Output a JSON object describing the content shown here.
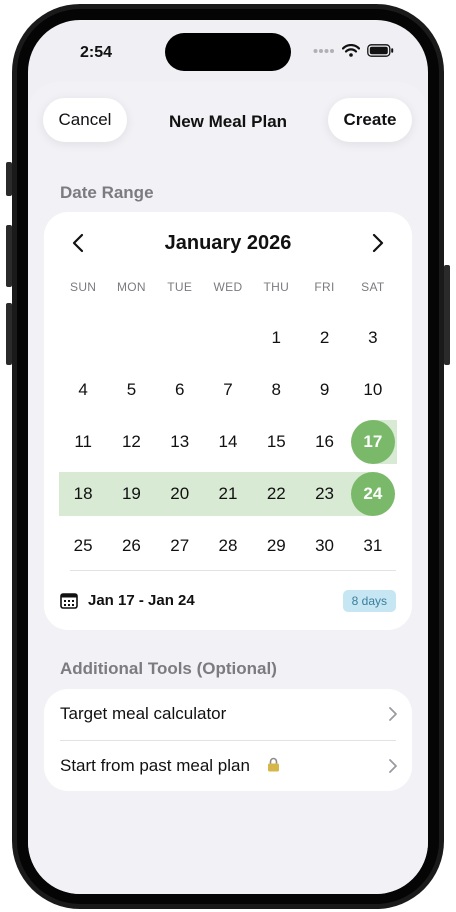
{
  "status_bar": {
    "time": "2:54"
  },
  "header": {
    "cancel_label": "Cancel",
    "title": "New Meal Plan",
    "create_label": "Create"
  },
  "date_range": {
    "section_label": "Date Range",
    "month_title": "January 2026",
    "weekdays": [
      "SUN",
      "MON",
      "TUE",
      "WED",
      "THU",
      "FRI",
      "SAT"
    ],
    "first_weekday_index": 4,
    "days_in_month": 31,
    "range_start": 17,
    "range_end": 24,
    "summary": "Jan 17 - Jan 24",
    "duration_badge": "8 days"
  },
  "additional_tools": {
    "section_label": "Additional Tools (Optional)",
    "items": [
      {
        "label": "Target meal calculator",
        "locked": false
      },
      {
        "label": "Start from past meal plan",
        "locked": true
      }
    ]
  },
  "colors": {
    "accent_green": "#7ab96a",
    "range_band": "#d8ead3",
    "badge_bg": "#c5e6f2",
    "badge_text": "#3b7f9b"
  }
}
